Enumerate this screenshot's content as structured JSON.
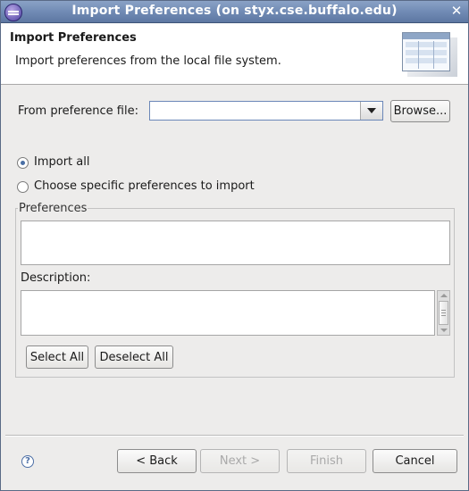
{
  "window": {
    "title": "Import Preferences  (on styx.cse.buffalo.edu)"
  },
  "header": {
    "title": "Import Preferences",
    "description": "Import preferences from the local file system."
  },
  "file_selector": {
    "label": "From preference file:",
    "value": "",
    "browse_label": "Browse..."
  },
  "import_mode": {
    "options": [
      {
        "label": "Import all",
        "selected": true
      },
      {
        "label": "Choose specific preferences to import",
        "selected": false
      }
    ]
  },
  "preferences_group": {
    "legend": "Preferences",
    "description_label": "Description:",
    "select_all_label": "Select All",
    "deselect_all_label": "Deselect All"
  },
  "footer": {
    "help_glyph": "?",
    "back_label": "< Back",
    "next_label": "Next >",
    "finish_label": "Finish",
    "cancel_label": "Cancel"
  }
}
